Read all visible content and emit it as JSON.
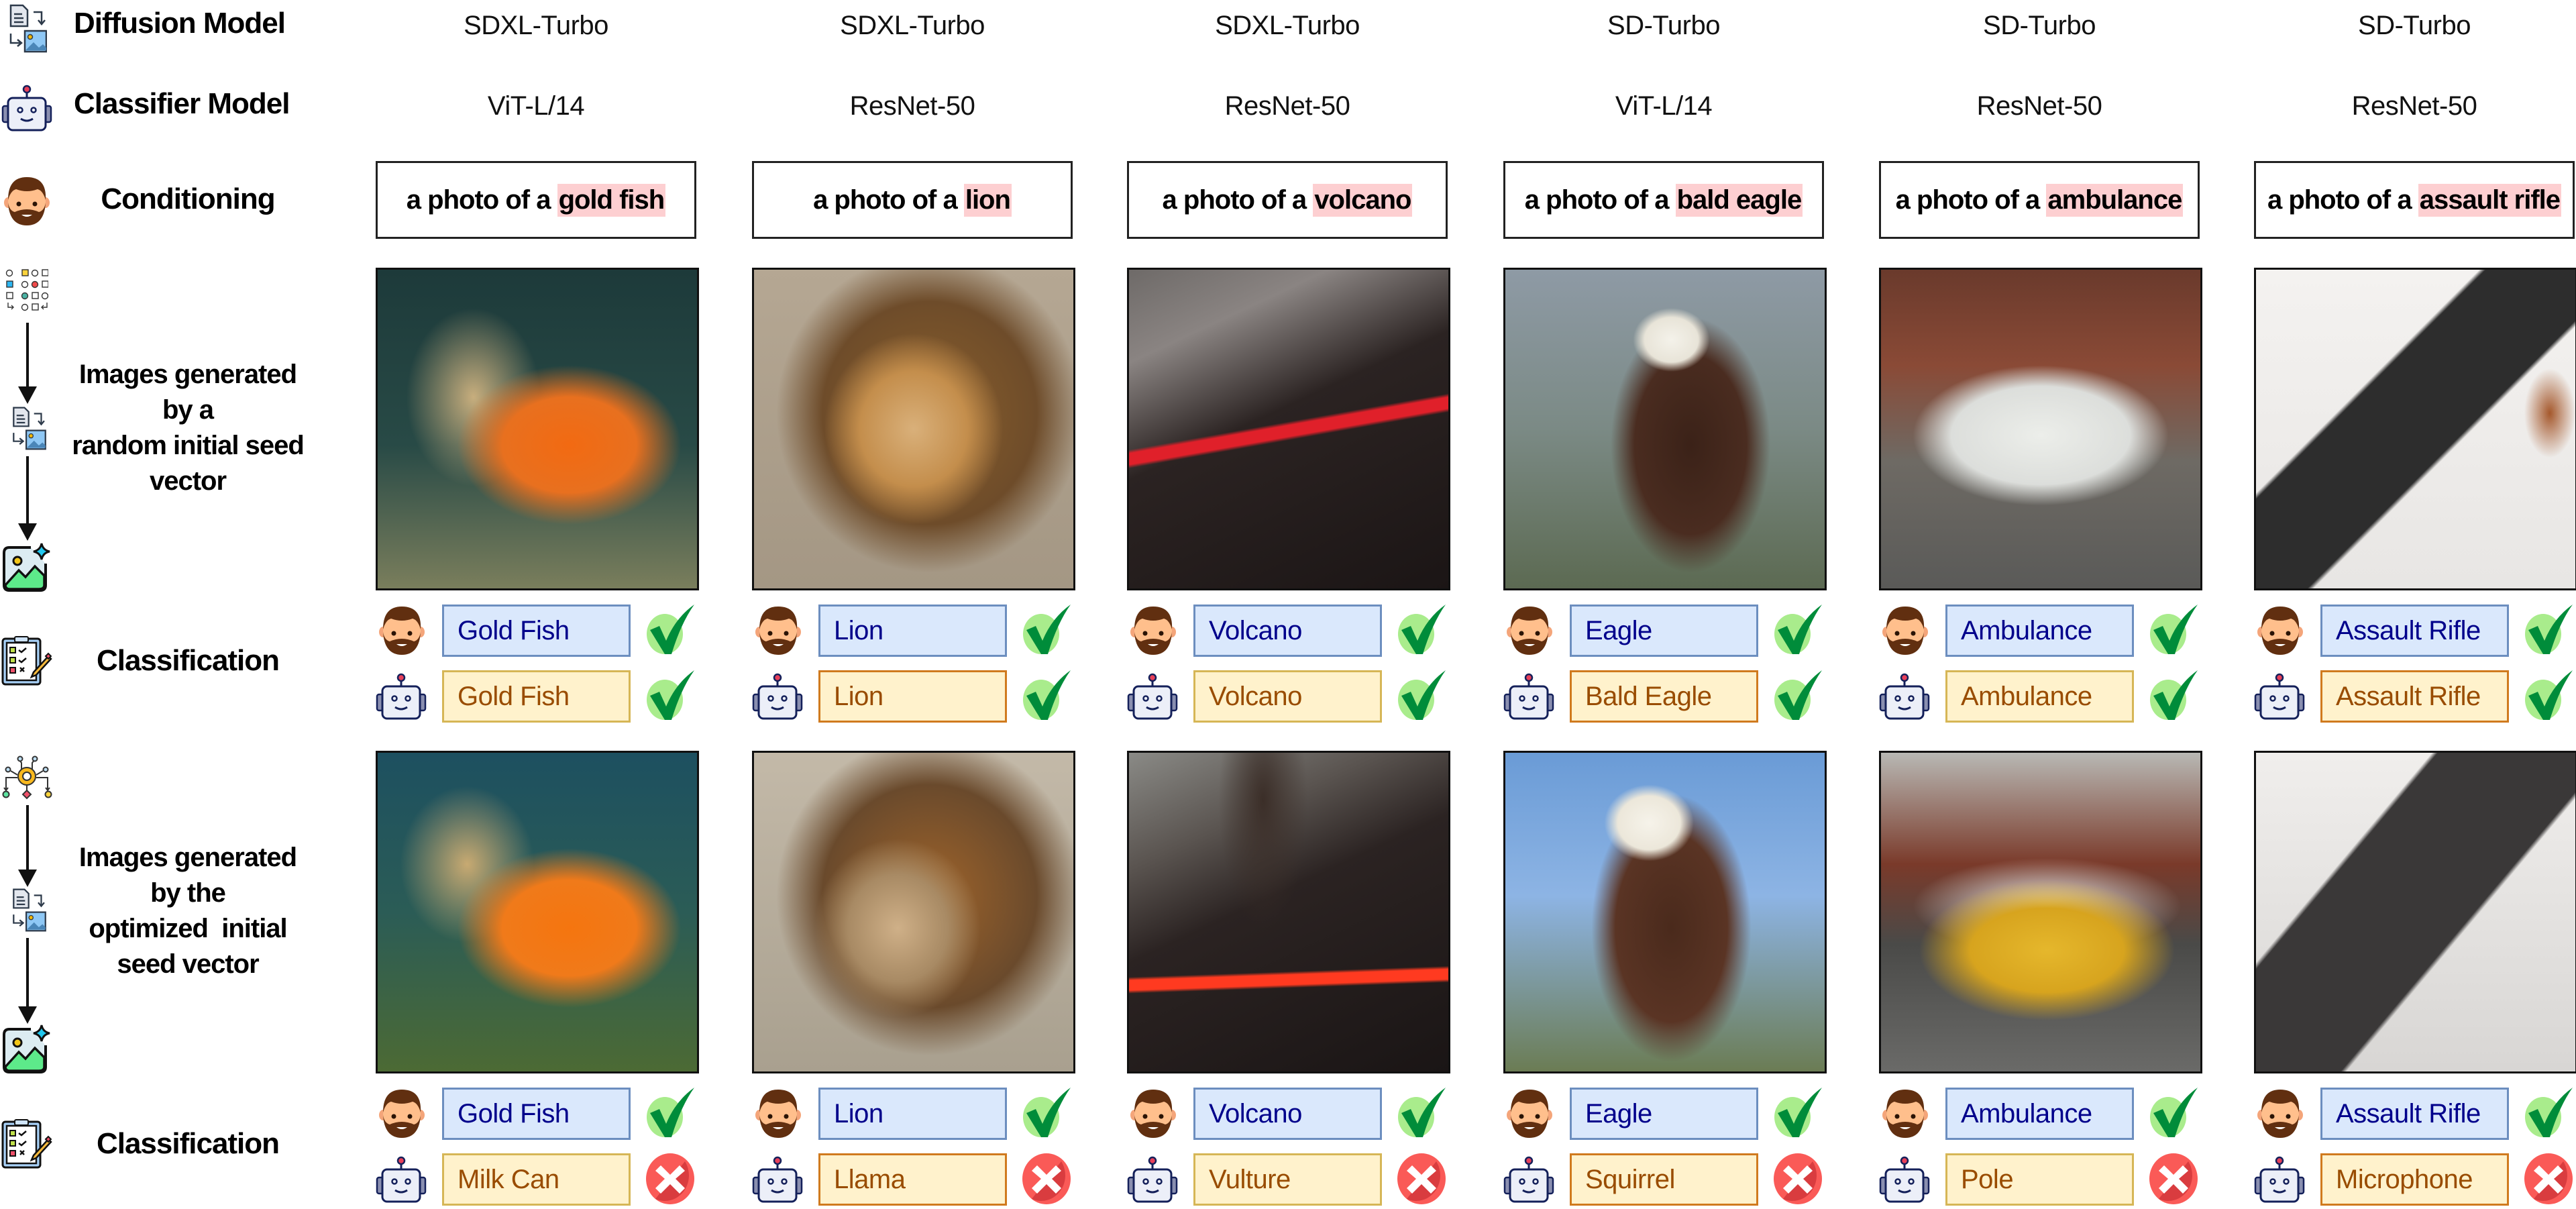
{
  "row_labels": {
    "diffusion_model": "Diffusion Model",
    "classifier_model": "Classifier Model",
    "conditioning": "Conditioning",
    "random_seed_images": [
      "Images generated",
      "by a",
      "random initial seed",
      "vector"
    ],
    "classification_1": "Classification",
    "optimized_seed_images": [
      "Images generated",
      "by the",
      "optimized  initial",
      "seed vector"
    ],
    "classification_2": "Classification"
  },
  "prompt_prefix": "a photo of a",
  "colors": {
    "human_label_bg": "#dae8fc",
    "human_label_border": "#6c8ebf",
    "human_label_text": "#00008b",
    "robot_label_bg": "#fff2cc",
    "robot_label_text": "#994c00",
    "prompt_highlight": "#fdcfd1",
    "check_green": "#008c3a",
    "cross_red": "#e84545"
  },
  "columns": [
    {
      "diffusion_model": "SDXL-Turbo",
      "classifier_model": "ViT-L/14",
      "prompt_object": "gold fish",
      "image_random": "goldfish photo",
      "random_human_label": "Gold Fish",
      "random_classifier_label": "Gold Fish",
      "random_result": "correct",
      "image_optimized": "goldfish photo (optimized seed)",
      "optimized_human_label": "Gold Fish",
      "optimized_classifier_label": "Milk Can",
      "optimized_result": "incorrect"
    },
    {
      "diffusion_model": "SDXL-Turbo",
      "classifier_model": "ResNet-50",
      "prompt_object": "lion",
      "image_random": "lion photo",
      "random_human_label": "Lion",
      "random_classifier_label": "Lion",
      "random_result": "correct",
      "image_optimized": "lion photo (optimized seed)",
      "optimized_human_label": "Lion",
      "optimized_classifier_label": "Llama",
      "optimized_result": "incorrect"
    },
    {
      "diffusion_model": "SDXL-Turbo",
      "classifier_model": "ResNet-50",
      "prompt_object": "volcano",
      "image_random": "volcano photo",
      "random_human_label": "Volcano",
      "random_classifier_label": "Volcano",
      "random_result": "correct",
      "image_optimized": "volcano photo (optimized seed)",
      "optimized_human_label": "Volcano",
      "optimized_classifier_label": "Vulture",
      "optimized_result": "incorrect"
    },
    {
      "diffusion_model": "SD-Turbo",
      "classifier_model": "ViT-L/14",
      "prompt_object": "bald eagle",
      "image_random": "bald eagle photo",
      "random_human_label": "Eagle",
      "random_classifier_label": "Bald Eagle",
      "random_result": "correct",
      "image_optimized": "bald eagle photo (optimized seed)",
      "optimized_human_label": "Eagle",
      "optimized_classifier_label": "Squirrel",
      "optimized_result": "incorrect"
    },
    {
      "diffusion_model": "SD-Turbo",
      "classifier_model": "ResNet-50",
      "prompt_object": "ambulance",
      "image_random": "ambulance photo",
      "random_human_label": "Ambulance",
      "random_classifier_label": "Ambulance",
      "random_result": "correct",
      "image_optimized": "ambulance photo (optimized seed)",
      "optimized_human_label": "Ambulance",
      "optimized_classifier_label": "Pole",
      "optimized_result": "incorrect"
    },
    {
      "diffusion_model": "SD-Turbo",
      "classifier_model": "ResNet-50",
      "prompt_object": "assault rifle",
      "image_random": "assault rifle photo",
      "random_human_label": "Assault Rifle",
      "random_classifier_label": "Assault Rifle",
      "random_result": "correct",
      "image_optimized": "assault rifle photo (optimized seed)",
      "optimized_human_label": "Assault Rifle",
      "optimized_classifier_label": "Microphone",
      "optimized_result": "incorrect"
    }
  ]
}
